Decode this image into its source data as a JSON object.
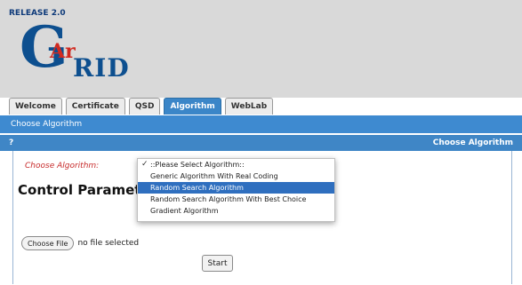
{
  "header": {
    "release": "RELEASE 2.0",
    "logo": {
      "g": "G",
      "ar": "Ar",
      "rid": "RID"
    }
  },
  "tabs": [
    {
      "label": "Welcome",
      "active": false
    },
    {
      "label": "Certificate",
      "active": false
    },
    {
      "label": "QSD",
      "active": false
    },
    {
      "label": "Algorithm",
      "active": true
    },
    {
      "label": "WebLab",
      "active": false
    }
  ],
  "breadcrumb": "Choose Algorithm",
  "panel": {
    "help": "?",
    "title": "Choose Algorithm",
    "choose_label": "Choose Algorithm:",
    "control_title": "Control Paramet",
    "dropdown": {
      "options": [
        "::Please Select Algorithm::",
        "Generic Algorithm With Real Coding",
        "Random Search Algorithm",
        "Random Search Algorithm With Best Choice",
        "Gradient Algorithm"
      ],
      "checked_index": 0,
      "highlighted_index": 2
    },
    "file": {
      "button": "Choose File",
      "status": "no file selected"
    },
    "start": "Start"
  },
  "colors": {
    "accent": "#3e8ad0",
    "highlight": "#2f6fbf",
    "label_red": "#c72b2b",
    "logo_blue": "#0d4f8f",
    "logo_red": "#d12a20"
  }
}
